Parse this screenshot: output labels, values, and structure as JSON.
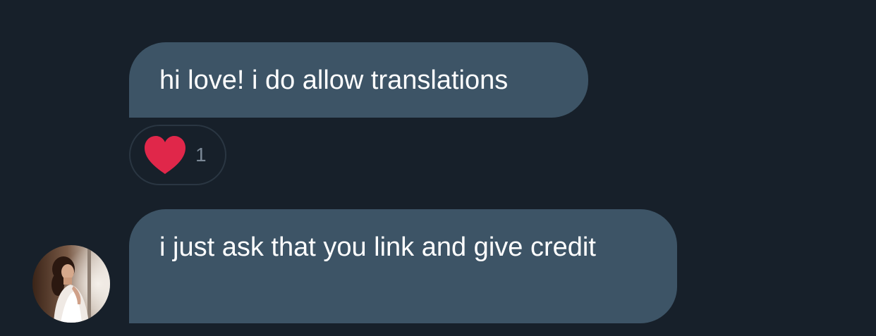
{
  "messages": [
    {
      "text": "hi love! i do allow translations",
      "reaction": {
        "icon": "heart-icon",
        "color": "#e0274a",
        "count": "1"
      }
    },
    {
      "text": "i just ask that you link and give credit"
    }
  ],
  "colors": {
    "background": "#17202a",
    "bubble": "#3d5466",
    "text": "#ffffff",
    "reaction_border": "#2a3642",
    "reaction_count": "#7b8896"
  }
}
